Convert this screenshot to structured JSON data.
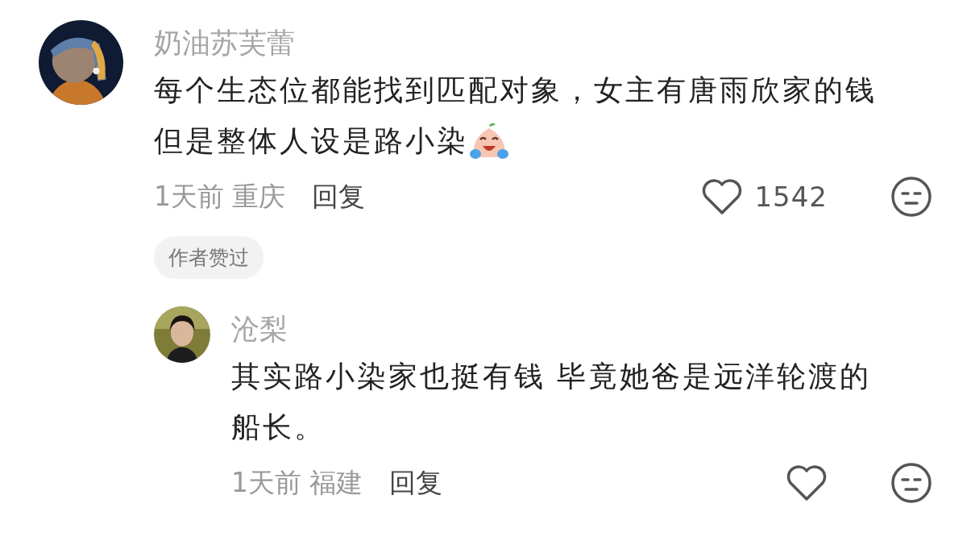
{
  "comments": [
    {
      "author": "奶油苏芙蕾",
      "lines": [
        "每个生态位都能找到匹配对象，女主有唐雨欣家的钱",
        "但是整体人设是路小染"
      ],
      "emoji": true,
      "time": "1天前 重庆",
      "reply_label": "回复",
      "likes": "1542",
      "badge": "作者赞过",
      "replies": [
        {
          "author": "沧梨",
          "lines": [
            "其实路小染家也挺有钱 毕竟她爸是远洋轮渡的",
            "船长。"
          ],
          "time": "1天前 福建",
          "reply_label": "回复"
        }
      ]
    }
  ]
}
